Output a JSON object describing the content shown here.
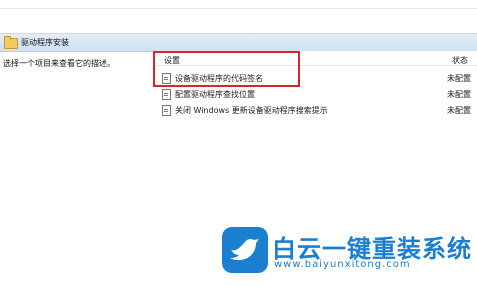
{
  "section": {
    "title": "驱动程序安装"
  },
  "description": "选择一个项目来查看它的描述。",
  "columns": {
    "setting": "设置",
    "status": "状态"
  },
  "rows": [
    {
      "label": "设备驱动程序的代码签名",
      "status": "未配置"
    },
    {
      "label": "配置驱动程序查找位置",
      "status": "未配置"
    },
    {
      "label": "关闭 Windows 更新设备驱动程序搜索提示",
      "status": "未配置"
    }
  ],
  "watermark": {
    "title": "白云一键重装系统",
    "url": "www.baiyunxitong.com"
  },
  "colors": {
    "highlight": "#d8242a",
    "brand": "#1b7fd1",
    "header_bg": "#d9e6f6"
  }
}
